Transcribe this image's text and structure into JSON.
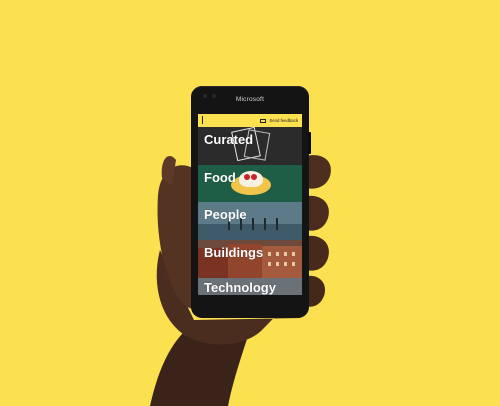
{
  "phone": {
    "brand": "Microsoft"
  },
  "app": {
    "logo_text": "",
    "feedback_label": "Send feedback",
    "feedback_icon": "mail-icon"
  },
  "categories": [
    {
      "label": "Curated"
    },
    {
      "label": "Food"
    },
    {
      "label": "People"
    },
    {
      "label": "Buildings"
    },
    {
      "label": "Technology"
    }
  ],
  "colors": {
    "background": "#fbe04f",
    "app_accent": "#fbe04f",
    "phone": "#141414"
  }
}
